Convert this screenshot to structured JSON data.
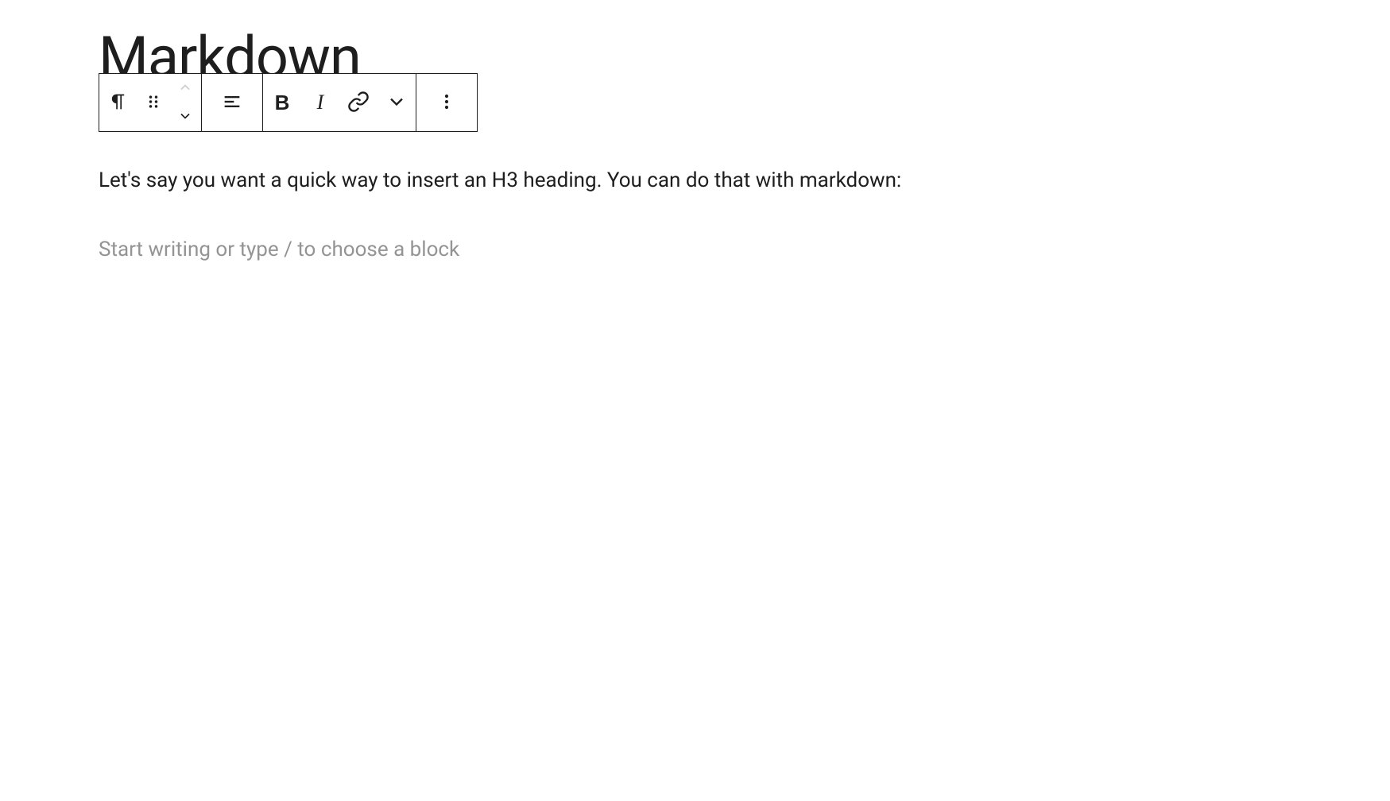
{
  "title": "Markdown",
  "toolbar": {
    "paragraph_icon": "paragraph",
    "drag_icon": "drag",
    "move_up_icon": "move-up",
    "move_down_icon": "move-down",
    "align_icon": "align-left",
    "bold_label": "B",
    "italic_label": "I",
    "link_icon": "link",
    "dropdown_icon": "chevron-down",
    "more_icon": "more-vertical"
  },
  "content": {
    "paragraph": "Let's say you want a quick way to insert an H3 heading. You can do that with markdown:",
    "placeholder": "Start writing or type / to choose a block"
  }
}
